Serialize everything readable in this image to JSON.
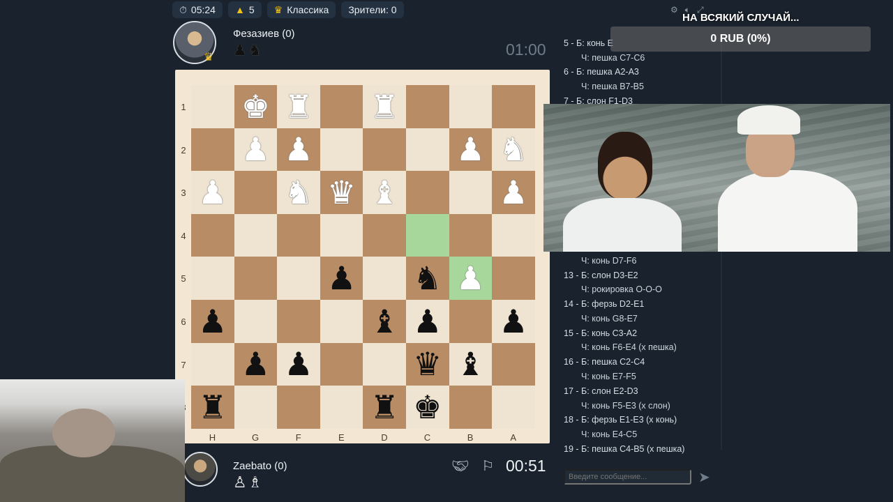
{
  "topbar": {
    "time": "05:24",
    "rating": "5",
    "mode": "Классика",
    "viewers": "Зрители: 0"
  },
  "top_player": {
    "name": "Фезазиев (0)",
    "captured": "♟♞",
    "timer": "01:00"
  },
  "bottom_player": {
    "name": "Zaebato (0)",
    "captured": "♙♗",
    "timer": "00:51"
  },
  "board": {
    "ranks": [
      "1",
      "2",
      "3",
      "4",
      "5",
      "6",
      "7",
      "8"
    ],
    "files": [
      "H",
      "G",
      "F",
      "E",
      "D",
      "C",
      "B",
      "A"
    ],
    "squares": [
      [
        "",
        "wK",
        "wR",
        "",
        "wR",
        "",
        "",
        ""
      ],
      [
        "",
        "wP",
        "wP",
        "",
        "",
        "",
        "wP",
        "wN"
      ],
      [
        "wP",
        "",
        "wN",
        "wQ",
        "wB",
        "",
        "",
        "wP"
      ],
      [
        "",
        "",
        "",
        "",
        "",
        "",
        "",
        ""
      ],
      [
        "",
        "",
        "",
        "bP",
        "",
        "bN",
        "wP",
        ""
      ],
      [
        "bP",
        "",
        "",
        "",
        "bB",
        "bP",
        "",
        "bP"
      ],
      [
        "",
        "bP",
        "bP",
        "",
        "",
        "bQ",
        "bB",
        ""
      ],
      [
        "bR",
        "",
        "",
        "",
        "bR",
        "bK",
        "",
        ""
      ]
    ],
    "highlight": [
      [
        3,
        5
      ],
      [
        4,
        6
      ]
    ]
  },
  "donation": {
    "title": "НА ВСЯКИЙ СЛУЧАЙ...",
    "amount": "0 RUB (0%)"
  },
  "moves": [
    {
      "text": "5 - Б: конь E",
      "sub": false
    },
    {
      "text": "Ч: пешка C7-C6",
      "sub": true
    },
    {
      "text": "6 - Б: пешка A2-A3",
      "sub": false
    },
    {
      "text": "Ч: пешка B7-B5",
      "sub": true
    },
    {
      "text": "7 - Б: слон F1-D3",
      "sub": false
    },
    {
      "text": "Ч: конь D7-F6",
      "sub": true
    },
    {
      "text": "13 - Б: слон D3-E2",
      "sub": false
    },
    {
      "text": "Ч: рокировка O-O-O",
      "sub": true
    },
    {
      "text": "14 - Б: ферзь D2-E1",
      "sub": false
    },
    {
      "text": "Ч: конь G8-E7",
      "sub": true
    },
    {
      "text": "15 - Б: конь C3-A2",
      "sub": false
    },
    {
      "text": "Ч: конь F6-E4 (x пешка)",
      "sub": true
    },
    {
      "text": "16 - Б: пешка C2-C4",
      "sub": false
    },
    {
      "text": "Ч: конь E7-F5",
      "sub": true
    },
    {
      "text": "17 - Б: слон E2-D3",
      "sub": false
    },
    {
      "text": "Ч: конь F5-E3 (x слон)",
      "sub": true
    },
    {
      "text": "18 - Б: ферзь E1-E3 (x конь)",
      "sub": false
    },
    {
      "text": "Ч: конь E4-C5",
      "sub": true
    },
    {
      "text": "19 - Б: пешка C4-B5 (x пешка)",
      "sub": false
    }
  ],
  "chat": {
    "placeholder": "Введите сообщение..."
  }
}
